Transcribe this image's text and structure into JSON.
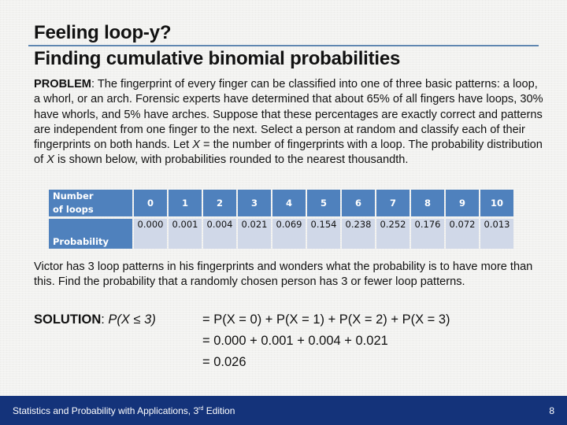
{
  "title": {
    "line1": "Feeling loop-y?",
    "line2": "Finding cumulative binomial probabilities"
  },
  "problem": {
    "label": "PROBLEM",
    "text_before_x1": ": The fingerprint of every finger can be classified into one of three basic patterns: a loop, a whorl, or an arch. Forensic experts have determined that about 65% of all fingers have loops, 30% have whorls, and 5% have arches. Suppose that these percentages are exactly correct and patterns are independent from one finger to the next. Select a person at random and classify each of their fingerprints on both hands. Let ",
    "var": "X",
    "text_mid": " = the number of fingerprints with a loop. The probability distribution of ",
    "text_after_x2": " is shown below, with probabilities rounded to the nearest thousandth."
  },
  "table": {
    "row1_label": "Number of loops",
    "row2_label": "Probability",
    "values": [
      "0",
      "1",
      "2",
      "3",
      "4",
      "5",
      "6",
      "7",
      "8",
      "9",
      "10"
    ],
    "probabilities": [
      "0.000",
      "0.001",
      "0.004",
      "0.021",
      "0.069",
      "0.154",
      "0.238",
      "0.252",
      "0.176",
      "0.072",
      "0.013"
    ]
  },
  "question": {
    "text": "Victor has 3 loop patterns in his fingerprints and wonders what the probability is to have more than this. Find the probability that a randomly chosen person has 3 or fewer loop patterns."
  },
  "solution": {
    "label": "SOLUTION",
    "lhs": "P(X ≤ 3)",
    "line1": "= P(X = 0) + P(X = 1) + P(X = 2) + P(X = 3)",
    "line2": "= 0.000 + 0.001 + 0.004 + 0.021",
    "line3": "= 0.026"
  },
  "footer": {
    "book_title": "Statistics and Probability with Applications, 3",
    "superscript": "rd",
    "edition": " Edition",
    "page_number": "8"
  },
  "colors": {
    "table_header": "#4f81bd",
    "table_body": "#d0d8e8",
    "footer_bg": "#14337a",
    "title_rule": "#5f86b0"
  }
}
